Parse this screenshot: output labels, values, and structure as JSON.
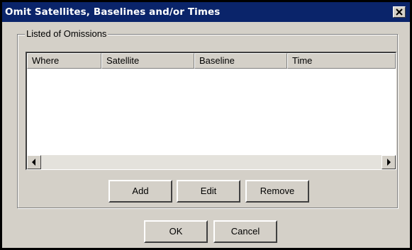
{
  "window": {
    "title": "Omit Satellites, Baselines and/or Times",
    "close_icon": "close-icon"
  },
  "group": {
    "label": "Listed of Omissions"
  },
  "list": {
    "columns": [
      "Where",
      "Satellite",
      "Baseline",
      "Time"
    ],
    "rows": []
  },
  "list_buttons": {
    "add": "Add",
    "edit": "Edit",
    "remove": "Remove"
  },
  "dialog_buttons": {
    "ok": "OK",
    "cancel": "Cancel"
  },
  "colors": {
    "titlebar": "#0a246a",
    "face": "#d4d0c8"
  }
}
